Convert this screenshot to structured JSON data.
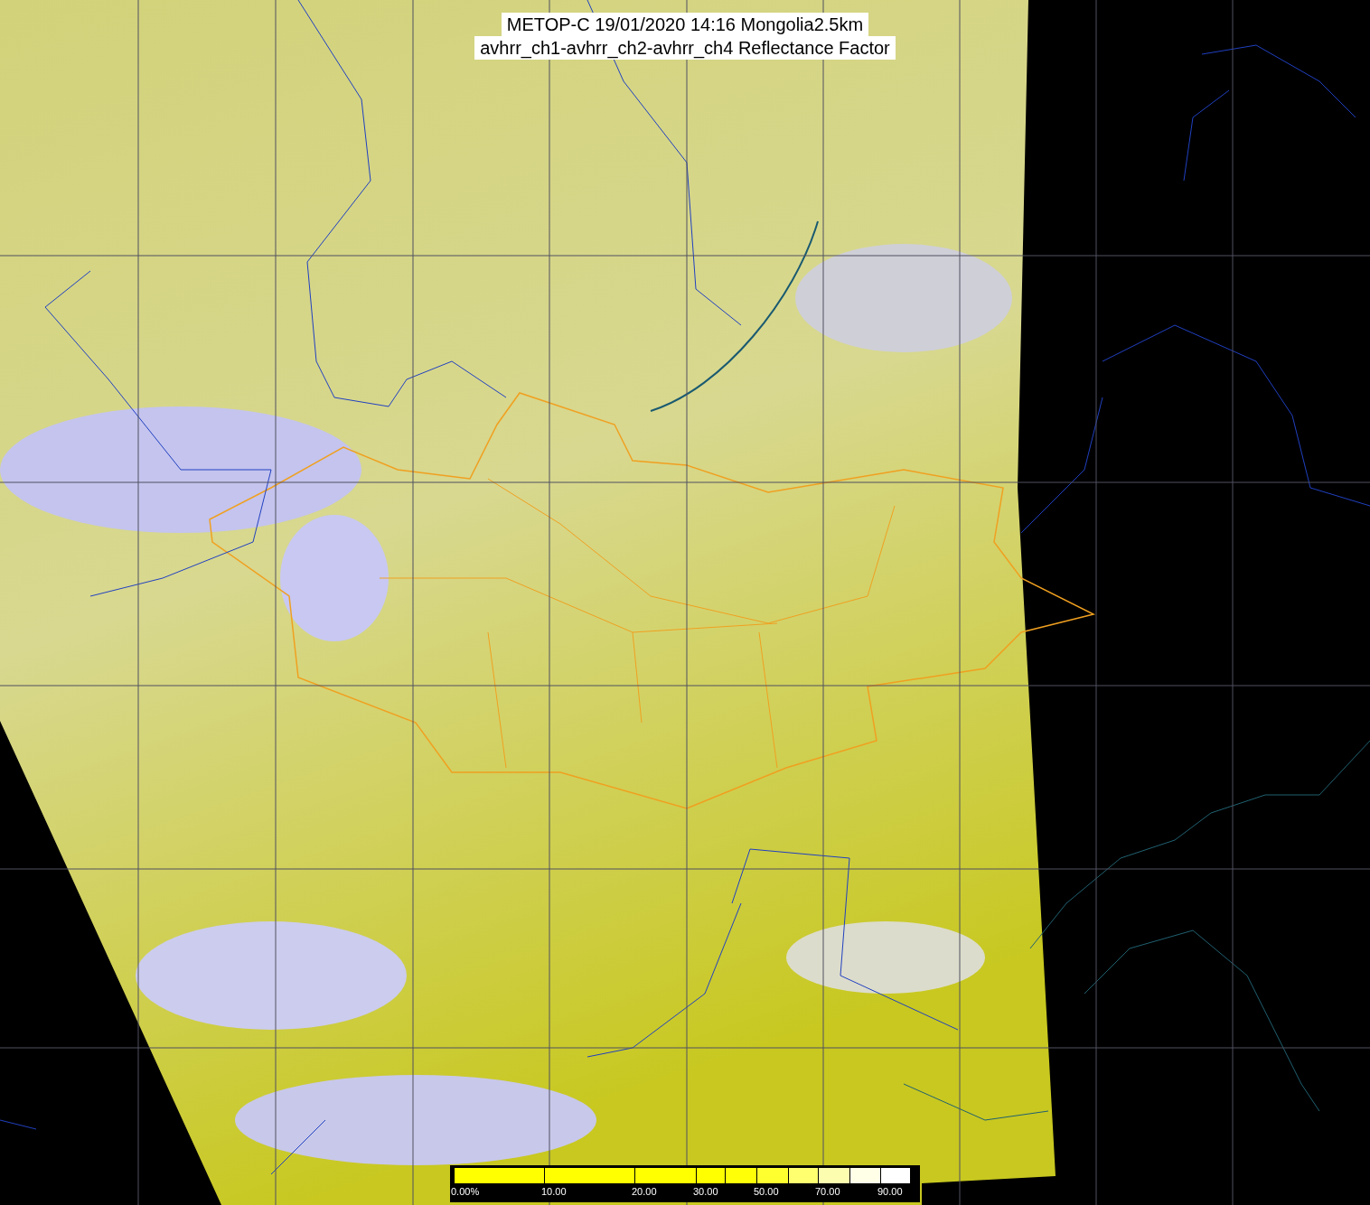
{
  "title": {
    "line1": "METOP-C 19/01/2020 14:16 Mongolia2.5km",
    "line2": "avhrr_ch1-avhrr_ch2-avhrr_ch4 Reflectance Factor"
  },
  "color_scale": [
    {
      "color": "#ffff00",
      "label": "0.00%"
    },
    {
      "color": "#ffff00",
      "label": "10.00"
    },
    {
      "color": "#ffff00",
      "label": "20.00"
    },
    {
      "color": "#ffff00",
      "label": "30.00"
    },
    {
      "color": "#ffff08"
    },
    {
      "color": "#ffff30",
      "label": "50.00"
    },
    {
      "color": "#ffff70"
    },
    {
      "color": "#fdfdb0",
      "label": "70.00"
    },
    {
      "color": "#ffffe8"
    },
    {
      "color": "#ffffff",
      "label": "90.00"
    }
  ]
}
